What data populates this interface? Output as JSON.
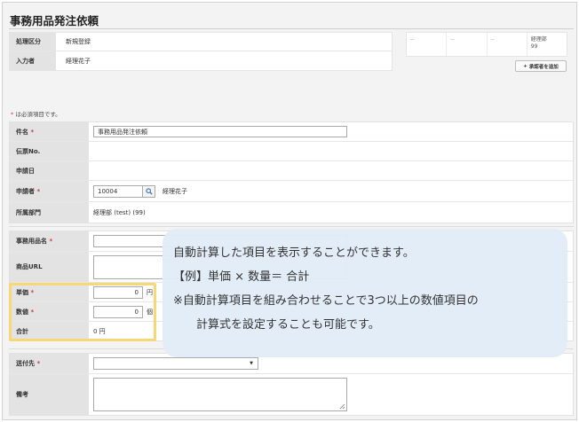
{
  "title": "事務用品発注依頼",
  "info": {
    "rows": [
      {
        "label": "処理区分",
        "value": "新規登録"
      },
      {
        "label": "入力者",
        "value": "経理花子"
      }
    ]
  },
  "approvers": {
    "cells": [
      "--",
      "--",
      "--"
    ],
    "last_line1": "経理部",
    "last_line2": "99",
    "add_button": "承認者を追加"
  },
  "required_note_mark": "*",
  "required_note": "は必須項目です。",
  "required_mark": "*",
  "form1": {
    "subject_label": "件名",
    "subject_value": "事務用品発注依頼",
    "slip_label": "伝票No.",
    "date_label": "申請日",
    "applicant_label": "申請者",
    "applicant_code": "10004",
    "applicant_name": "経理花子",
    "dept_label": "所属部門",
    "dept_value": "経理部 (test) (99)"
  },
  "form2": {
    "item_label": "事務用品名",
    "url_label": "商品URL",
    "price_label": "単価",
    "price_value": "0",
    "price_unit": "円",
    "qty_label": "数値",
    "qty_value": "0",
    "qty_unit": "個",
    "total_label": "合計",
    "total_value": "0 円"
  },
  "form3": {
    "dest_label": "送付先",
    "note_label": "備考"
  },
  "callout": {
    "line1": "自動計算した項目を表示することができます。",
    "line2": "【例】単価 × 数量＝ 合計",
    "line3": "※自動計算項目を組み合わせることで3つ以上の数値項目の",
    "line4": "計算式を設定することも可能です。"
  },
  "colors": {
    "highlight": "#f7d878",
    "callout_bg": "#e2ecf7",
    "required": "#d13b3b",
    "label_bg": "#e3e3e3"
  }
}
